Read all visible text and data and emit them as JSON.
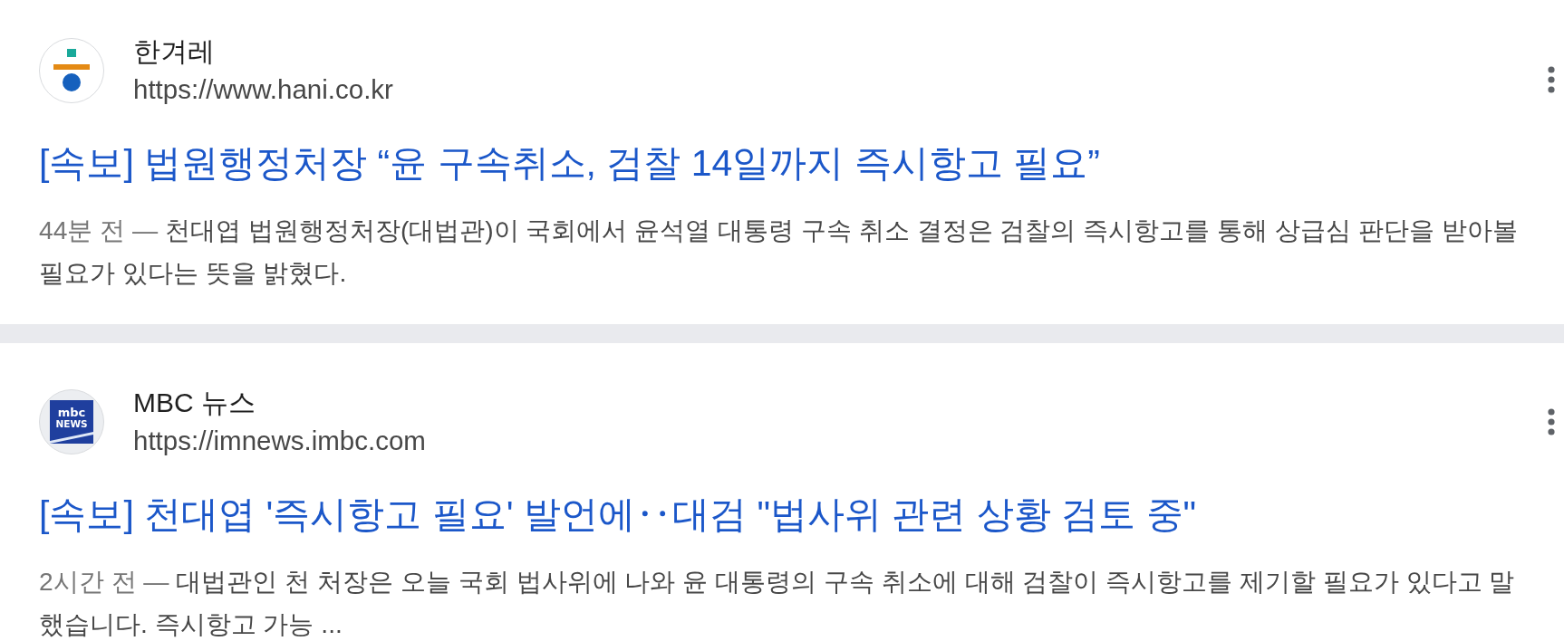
{
  "results": [
    {
      "source": {
        "name": "한겨레",
        "url": "https://www.hani.co.kr",
        "logo": {
          "kind": "hani"
        }
      },
      "title": "[속보] 법원행정처장 “윤 구속취소, 검찰 14일까지 즉시항고 필요”",
      "time": "44분 전",
      "separator": "—",
      "snippet": "천대엽 법원행정처장(대법관)이 국회에서 윤석열 대통령 구속 취소 결정은 검찰의 즉시항고를 통해 상급심 판단을 받아볼 필요가 있다는 뜻을 밝혔다."
    },
    {
      "source": {
        "name": "MBC 뉴스",
        "url": "https://imnews.imbc.com",
        "logo": {
          "kind": "mbc",
          "lines": [
            "mbc",
            "NEWS"
          ]
        }
      },
      "title": "[속보] 천대엽 '즉시항고 필요' 발언에‥대검 \"법사위 관련 상황 검토 중\"",
      "time": "2시간 전",
      "separator": "—",
      "snippet": "대법관인 천 처장은 오늘 국회 법사위에 나와 윤 대통령의 구속 취소에 대해 검찰이 즉시항고를 제기할 필요가 있다고 말했습니다. 즉시항고 가능 ..."
    }
  ]
}
